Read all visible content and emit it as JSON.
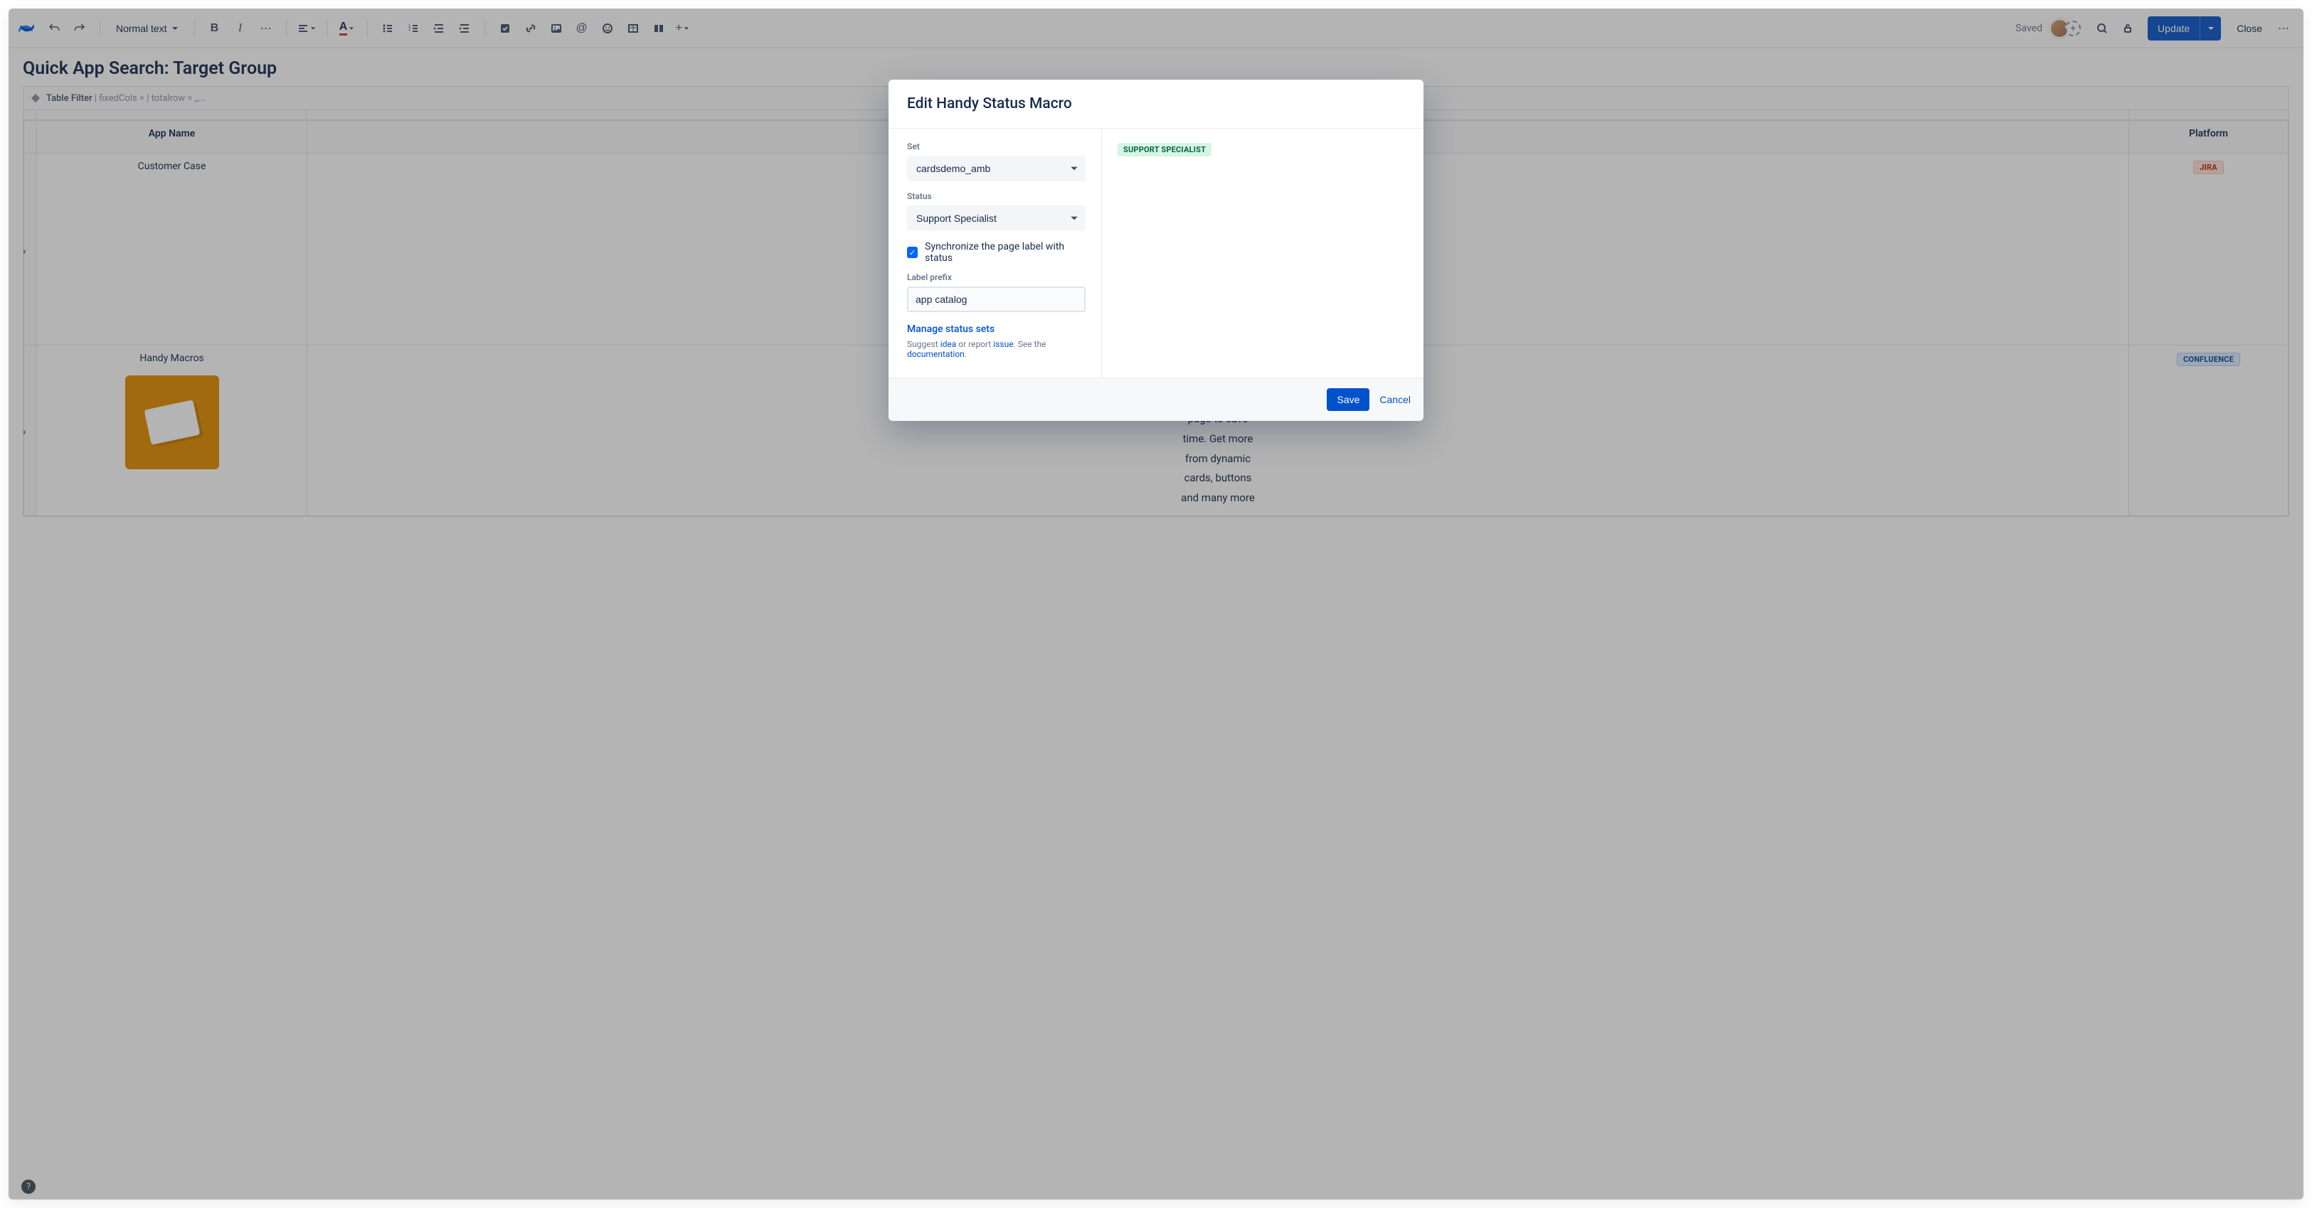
{
  "toolbar": {
    "text_style_label": "Normal text",
    "saved_label": "Saved",
    "update_label": "Update",
    "close_label": "Close"
  },
  "page": {
    "title": "Quick App Search: Target Group",
    "macro_bar": {
      "name": "Table Filter",
      "params": "| fixedCols = | totalrow = ,,..."
    }
  },
  "table": {
    "headers": {
      "app_name": "App Name",
      "platform": "Platform"
    },
    "rows": [
      {
        "app_name": "Customer Case",
        "platform_badge": "JIRA",
        "platform_badge_class": "badge-jira"
      },
      {
        "app_name": "Handy Macros",
        "platform_badge": "CONFLUENCE",
        "platform_badge_class": "badge-conf",
        "description": "page to save time. Get more from dynamic cards, buttons and many more"
      }
    ]
  },
  "modal": {
    "title": "Edit Handy Status Macro",
    "form": {
      "set_label": "Set",
      "set_value": "cardsdemo_amb",
      "status_label": "Status",
      "status_value": "Support Specialist",
      "sync_label": "Synchronize the page label with status",
      "sync_checked": true,
      "prefix_label": "Label prefix",
      "prefix_value": "app catalog",
      "manage_link": "Manage status sets",
      "suggest_pre": "Suggest ",
      "suggest_idea": "idea",
      "suggest_mid": " or report ",
      "suggest_issue": "issue",
      "suggest_see": ". See the ",
      "suggest_doc": "documentation",
      "suggest_end": "."
    },
    "preview_badge": "SUPPORT SPECIALIST",
    "footer": {
      "save": "Save",
      "cancel": "Cancel"
    }
  }
}
